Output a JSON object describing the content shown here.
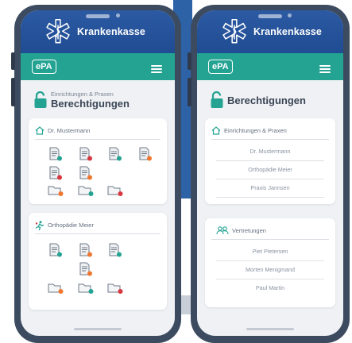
{
  "app": {
    "brand": "Krankenkasse",
    "epa_label": "ePA"
  },
  "colors": {
    "header_blue": "#2557a0",
    "teal": "#24a393",
    "red": "#d9363e",
    "orange": "#f0762f",
    "phone_frame": "#3c4b60"
  },
  "left_screen": {
    "title_small": "Einrichtungen & Praxen",
    "title_big": "Berechtigungen",
    "cards": [
      {
        "icon": "home-icon",
        "label": "Dr. Mustermann",
        "doc_icons": [
          "doc-teal-badge-icon",
          "doc-red-badge-icon",
          "doc-teal-badge-icon",
          "doc-orange-badge-icon",
          "doc-red-badge-icon",
          "doc-orange-badge-icon"
        ],
        "folder_icons": [
          "folder-orange-badge-icon",
          "folder-teal-badge-icon",
          "folder-red-badge-icon"
        ]
      },
      {
        "icon": "runner-icon",
        "label": "Orthopädie Meier",
        "doc_icons": [
          "doc-teal-badge-icon",
          "doc-orange-badge-icon",
          "doc-teal-badge-icon",
          "doc-orange-badge-icon"
        ],
        "folder_icons": [
          "folder-orange-badge-icon",
          "folder-teal-badge-icon",
          "folder-red-badge-icon"
        ]
      }
    ]
  },
  "right_screen": {
    "title_big": "Berechtigungen",
    "section_institutions": {
      "icon": "home-icon",
      "label": "Einrichtungen & Praxen",
      "items": [
        "Dr. Mustermann",
        "Orthopädie Meier",
        "Praxis Jannsen"
      ]
    },
    "section_representatives": {
      "icon": "people-icon",
      "label": "Vertretungen",
      "items": [
        "Piet Pietersen",
        "Morten Menigmand",
        "Paul Martin"
      ]
    }
  }
}
